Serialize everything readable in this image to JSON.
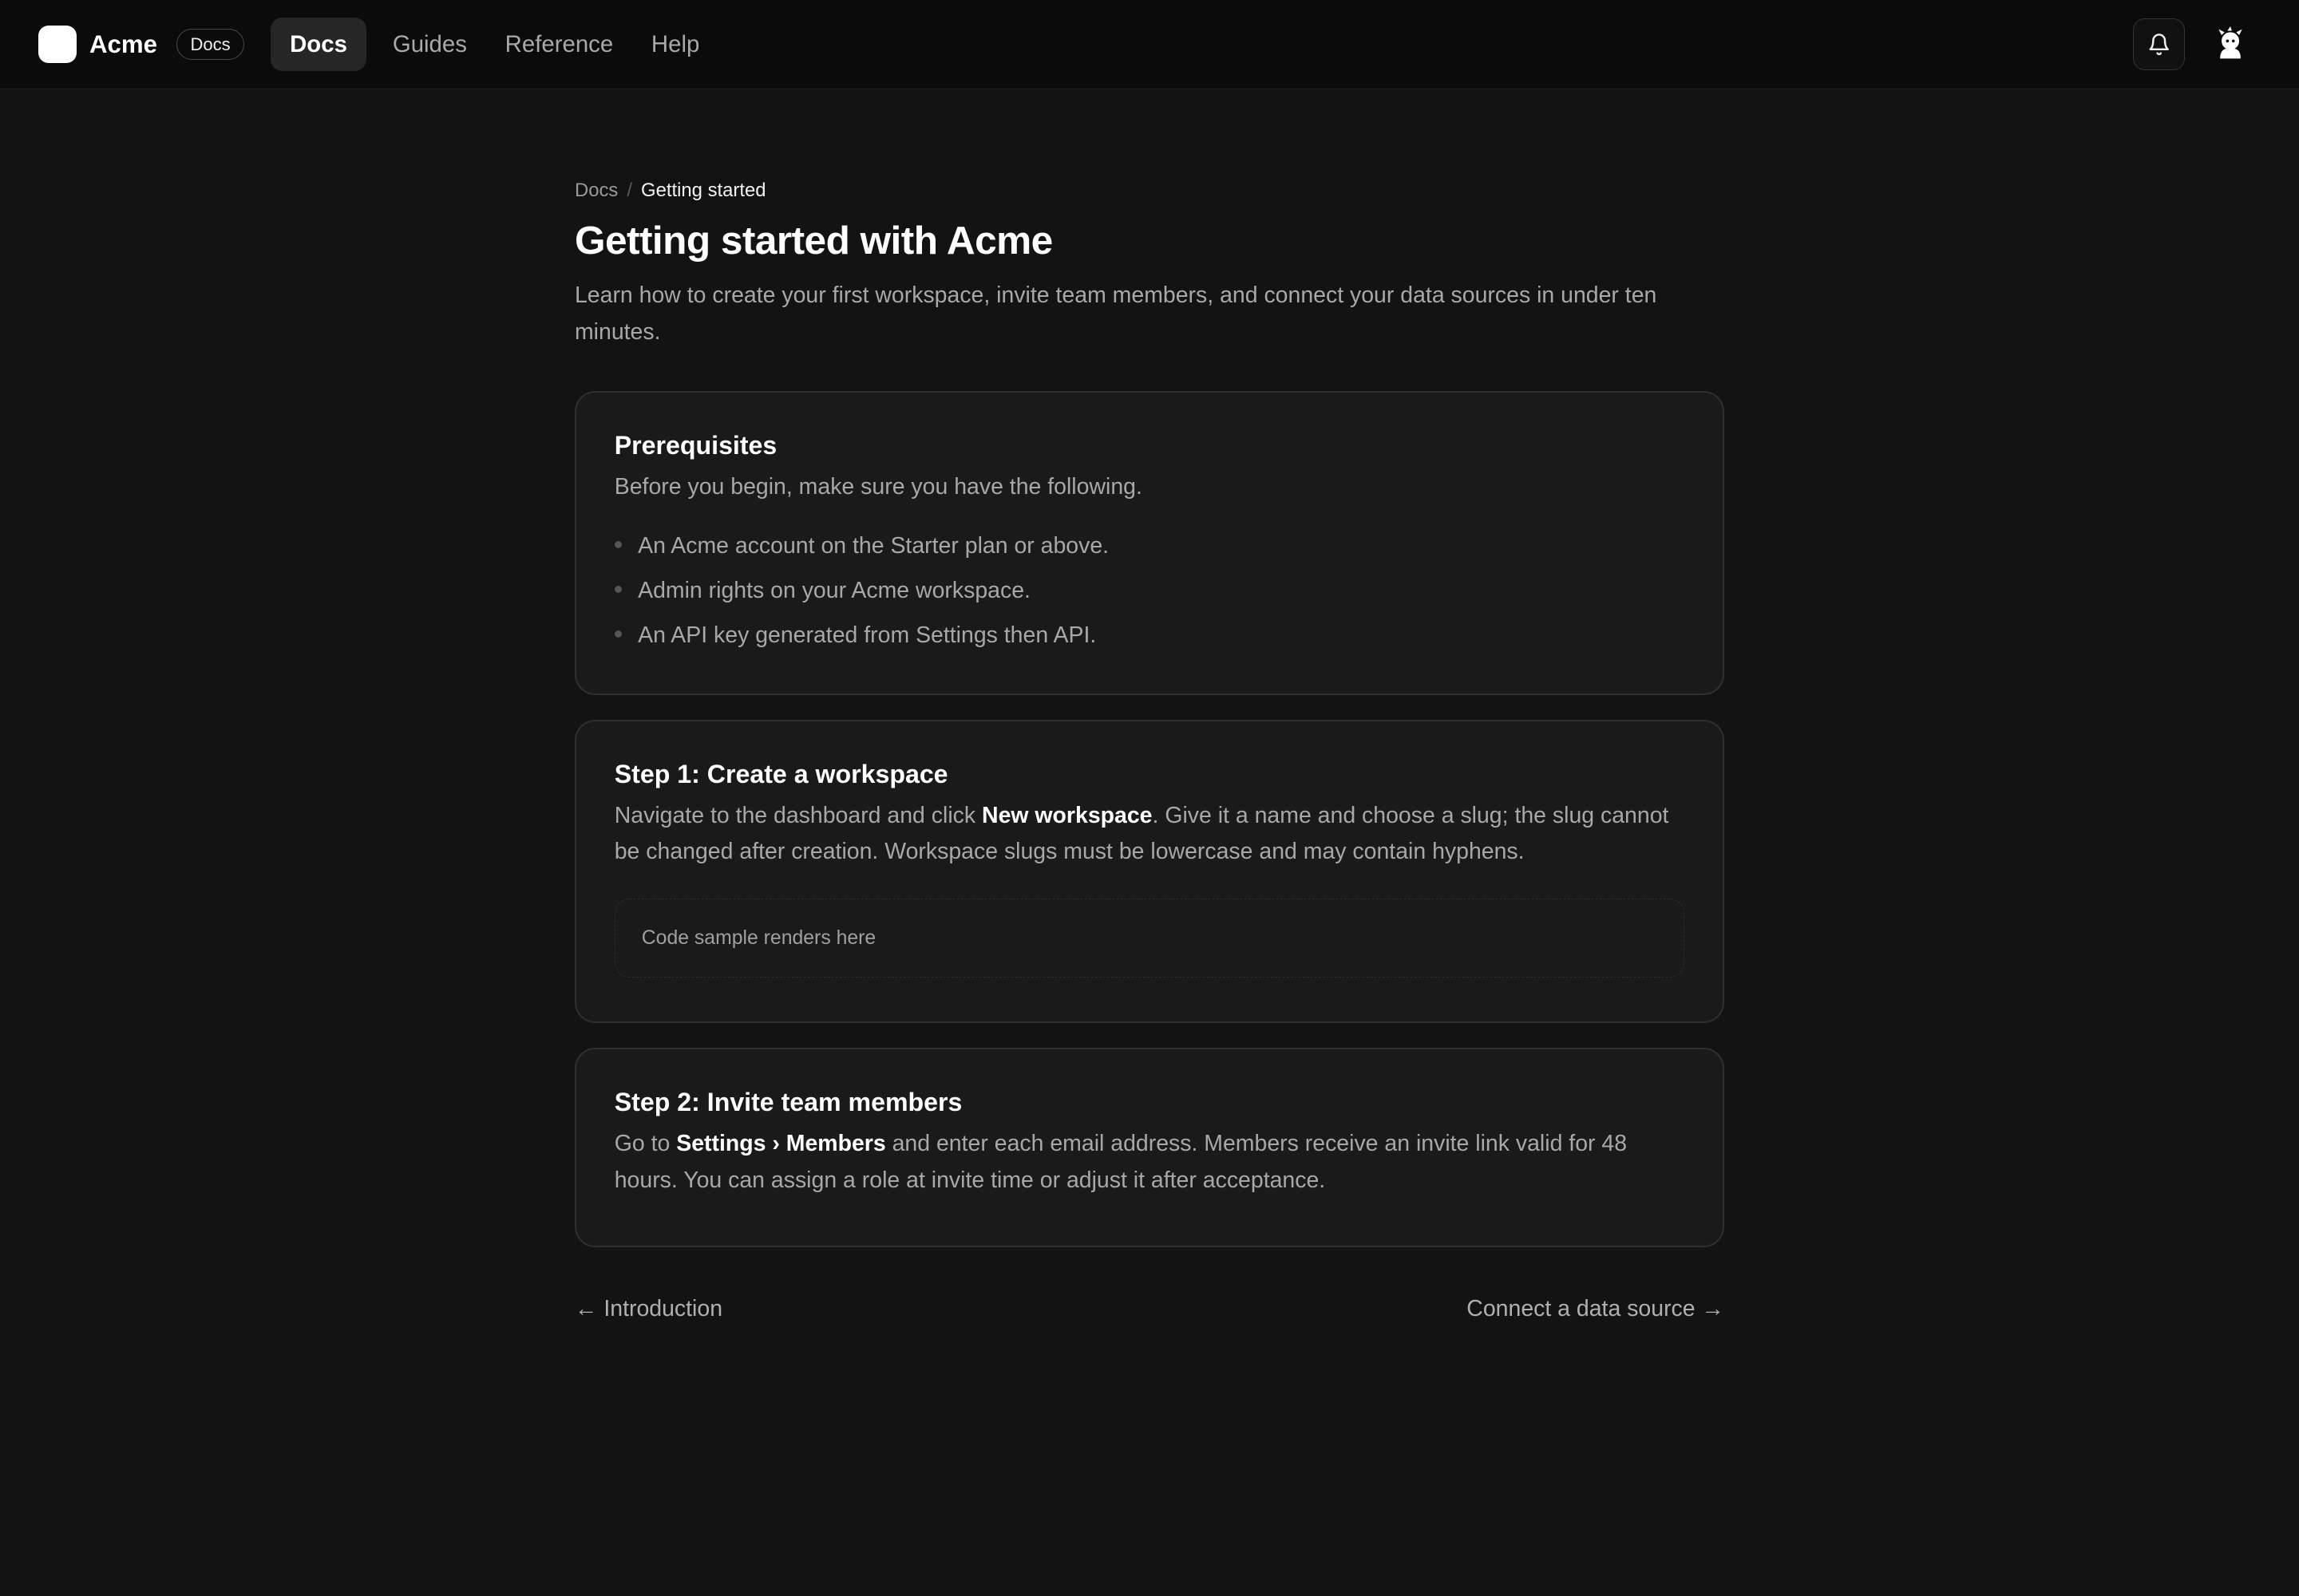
{
  "header": {
    "brand": "Acme",
    "badge": "Docs",
    "tabs": [
      {
        "label": "Docs",
        "active": true
      },
      {
        "label": "Guides",
        "active": false
      },
      {
        "label": "Reference",
        "active": false
      },
      {
        "label": "Help",
        "active": false
      }
    ],
    "icons": [
      "bell-icon",
      "avatar-icon"
    ]
  },
  "breadcrumb": {
    "root": "Docs",
    "separator": "/",
    "current": "Getting started"
  },
  "page": {
    "title": "Getting started with Acme",
    "lead": "Learn how to create your first workspace, invite team members, and connect your data sources in under ten minutes."
  },
  "prerequisites": {
    "title": "Prerequisites",
    "intro": "Before you begin, make sure you have the following.",
    "items": [
      "An Acme account on the Starter plan or above.",
      "Admin rights on your Acme workspace.",
      "An API key generated from Settings then API."
    ]
  },
  "step1": {
    "title": "Step 1: Create a workspace",
    "text_before": "Navigate to the dashboard and click ",
    "text_strong": "New workspace",
    "text_after": ". Give it a name and choose a slug; the slug cannot be changed after creation. Workspace slugs must be lowercase and may contain hyphens.",
    "code_placeholder": "Code sample renders here"
  },
  "step2": {
    "title": "Step 2: Invite team members",
    "text_before": "Go to ",
    "text_strong": "Settings › Members",
    "text_after": " and enter each email address. Members receive an invite link valid for 48 hours. You can assign a role at invite time or adjust it after acceptance."
  },
  "pager": {
    "prev": "← Introduction",
    "next": "Connect a data source →"
  },
  "colors": {
    "background": "#121212",
    "topbar": "#0b0b0b",
    "card": "#1a1a1a",
    "text": "#a8a8a8",
    "heading": "#ffffff"
  }
}
